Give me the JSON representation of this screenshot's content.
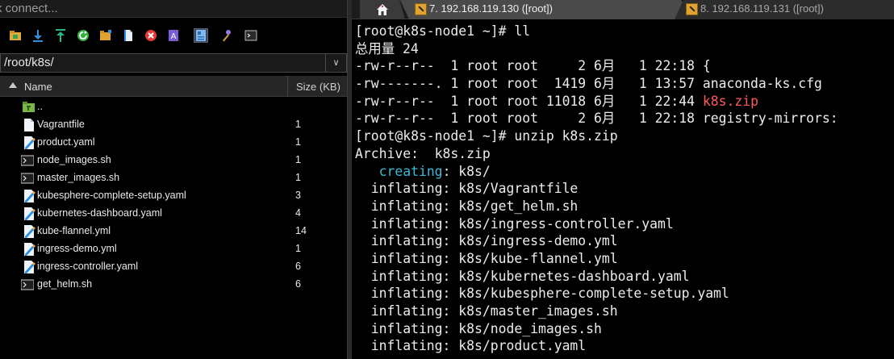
{
  "quick_connect": {
    "placeholder": "k connect..."
  },
  "toolbar": {
    "icons": [
      "home-folder-icon",
      "download-icon",
      "upload-icon",
      "refresh-icon",
      "new-folder-icon",
      "new-file-icon",
      "delete-icon",
      "text-editor-icon",
      "properties-icon",
      "settings-icon",
      "terminal-icon"
    ]
  },
  "path": {
    "value": "/root/k8s/"
  },
  "file_list": {
    "columns": {
      "name": "Name",
      "size": "Size (KB)"
    },
    "rows": [
      {
        "name": "..",
        "size": "",
        "icon": "parent-folder-icon"
      },
      {
        "name": "Vagrantfile",
        "size": "1",
        "icon": "file-icon"
      },
      {
        "name": "product.yaml",
        "size": "1",
        "icon": "yaml-file-icon"
      },
      {
        "name": "node_images.sh",
        "size": "1",
        "icon": "shell-script-icon"
      },
      {
        "name": "master_images.sh",
        "size": "1",
        "icon": "shell-script-icon"
      },
      {
        "name": "kubesphere-complete-setup.yaml",
        "size": "3",
        "icon": "yaml-file-icon"
      },
      {
        "name": "kubernetes-dashboard.yaml",
        "size": "4",
        "icon": "yaml-file-icon"
      },
      {
        "name": "kube-flannel.yml",
        "size": "14",
        "icon": "yaml-file-icon"
      },
      {
        "name": "ingress-demo.yml",
        "size": "1",
        "icon": "yaml-file-icon"
      },
      {
        "name": "ingress-controller.yaml",
        "size": "6",
        "icon": "yaml-file-icon"
      },
      {
        "name": "get_helm.sh",
        "size": "6",
        "icon": "shell-script-icon"
      }
    ]
  },
  "tabs": {
    "active": {
      "label": "7. 192.168.119.130 ([root])",
      "close": "×"
    },
    "inactive": {
      "label": "8. 192.168.119.131 ([root])"
    }
  },
  "terminal": {
    "lines": [
      {
        "parts": [
          {
            "text": "[root@k8s-node1 ~]# ll"
          }
        ]
      },
      {
        "parts": [
          {
            "text": "总用量 24"
          }
        ]
      },
      {
        "parts": [
          {
            "text": "-rw-r--r--  1 root root     2 6月   1 22:18 {"
          }
        ]
      },
      {
        "parts": [
          {
            "text": "-rw-------. 1 root root  1419 6月   1 13:57 anaconda-ks.cfg"
          }
        ]
      },
      {
        "parts": [
          {
            "text": "-rw-r--r--  1 root root 11018 6月   1 22:44 "
          },
          {
            "text": "k8s.zip",
            "color": "red"
          }
        ]
      },
      {
        "parts": [
          {
            "text": "-rw-r--r--  1 root root     2 6月   1 22:18 registry-mirrors:"
          }
        ]
      },
      {
        "parts": [
          {
            "text": "[root@k8s-node1 ~]# unzip k8s.zip"
          }
        ]
      },
      {
        "parts": [
          {
            "text": "Archive:  k8s.zip"
          }
        ]
      },
      {
        "parts": [
          {
            "text": "   "
          },
          {
            "text": "creating",
            "color": "cyan"
          },
          {
            "text": ": k8s/"
          }
        ]
      },
      {
        "parts": [
          {
            "text": "  inflating: k8s/Vagrantfile"
          }
        ]
      },
      {
        "parts": [
          {
            "text": "  inflating: k8s/get_helm.sh"
          }
        ]
      },
      {
        "parts": [
          {
            "text": "  inflating: k8s/ingress-controller.yaml"
          }
        ]
      },
      {
        "parts": [
          {
            "text": "  inflating: k8s/ingress-demo.yml"
          }
        ]
      },
      {
        "parts": [
          {
            "text": "  inflating: k8s/kube-flannel.yml"
          }
        ]
      },
      {
        "parts": [
          {
            "text": "  inflating: k8s/kubernetes-dashboard.yaml"
          }
        ]
      },
      {
        "parts": [
          {
            "text": "  inflating: k8s/kubesphere-complete-setup.yaml"
          }
        ]
      },
      {
        "parts": [
          {
            "text": "  inflating: k8s/master_images.sh"
          }
        ]
      },
      {
        "parts": [
          {
            "text": "  inflating: k8s/node_images.sh"
          }
        ]
      },
      {
        "parts": [
          {
            "text": "  inflating: k8s/product.yaml"
          }
        ]
      }
    ]
  },
  "colors": {
    "cyan": "#3fb8d8",
    "red": "#ff5a5a",
    "tab_icon": "#e2a232"
  }
}
